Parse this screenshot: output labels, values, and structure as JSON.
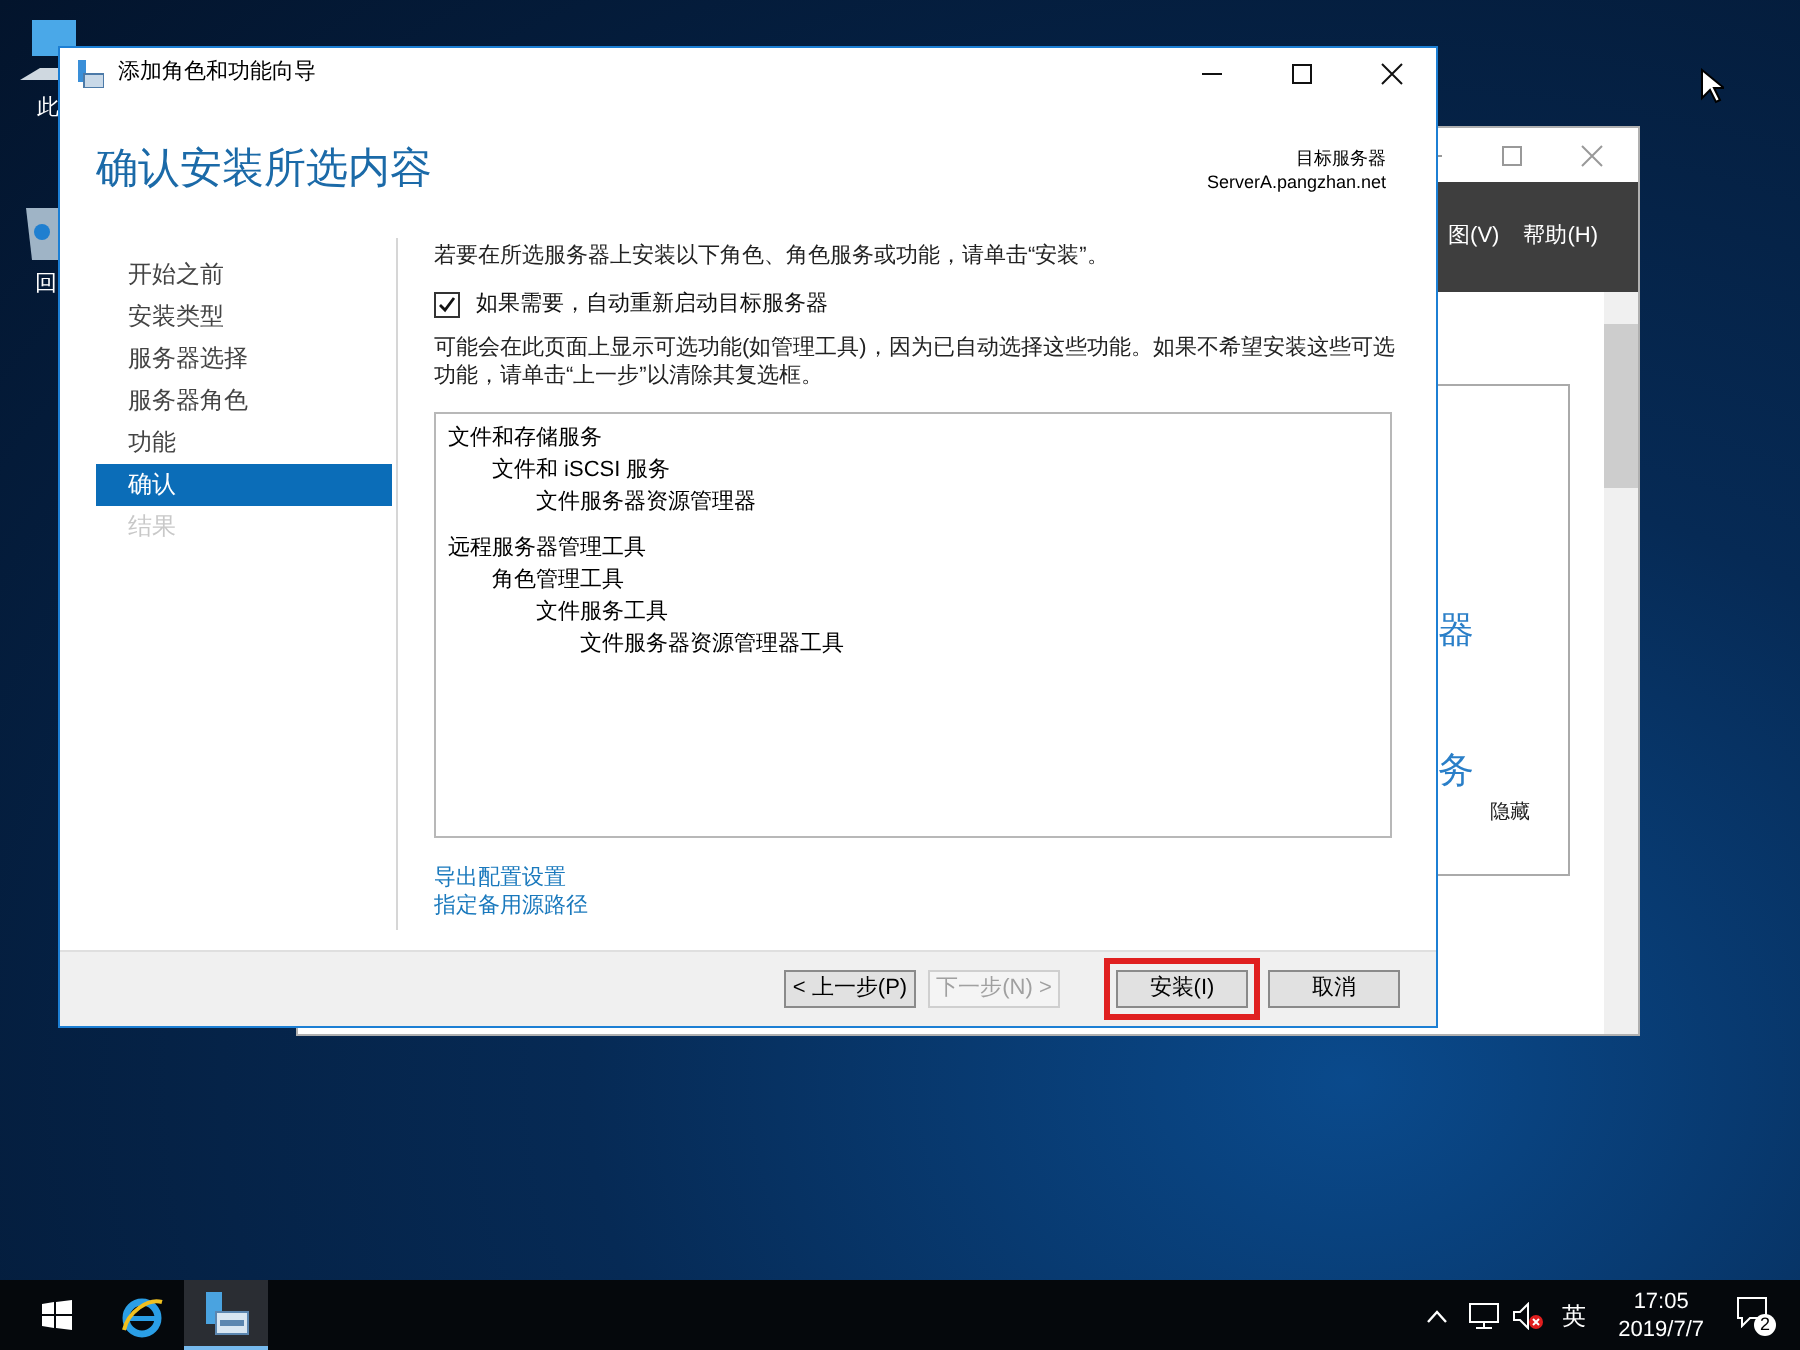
{
  "desktop_icons": [
    {
      "label": "此"
    },
    {
      "label": "回"
    }
  ],
  "background_window": {
    "menu": [
      "图(V)",
      "帮助(H)"
    ],
    "content_texts": [
      "器",
      "务"
    ],
    "hide_label": "隐藏"
  },
  "dialog": {
    "title": "添加角色和功能向导",
    "heading": "确认安装所选内容",
    "target_label": "目标服务器",
    "target_server": "ServerA.pangzhan.net",
    "steps": [
      {
        "label": "开始之前",
        "selected": false,
        "disabled": false
      },
      {
        "label": "安装类型",
        "selected": false,
        "disabled": false
      },
      {
        "label": "服务器选择",
        "selected": false,
        "disabled": false
      },
      {
        "label": "服务器角色",
        "selected": false,
        "disabled": false
      },
      {
        "label": "功能",
        "selected": false,
        "disabled": false
      },
      {
        "label": "确认",
        "selected": true,
        "disabled": false
      },
      {
        "label": "结果",
        "selected": false,
        "disabled": true
      }
    ],
    "intro": "若要在所选服务器上安装以下角色、角色服务或功能，请单击“安装”。",
    "restart_checkbox": {
      "label": "如果需要，自动重新启动目标服务器",
      "checked": true
    },
    "note": "可能会在此页面上显示可选功能(如管理工具)，因为已自动选择这些功能。如果不希望安装这些可选功能，请单击“上一步”以清除其复选框。",
    "tree": [
      {
        "label": "文件和存储服务",
        "children": [
          {
            "label": "文件和 iSCSI 服务",
            "children": [
              {
                "label": "文件服务器资源管理器"
              }
            ]
          }
        ]
      },
      {
        "label": "远程服务器管理工具",
        "children": [
          {
            "label": "角色管理工具",
            "children": [
              {
                "label": "文件服务工具",
                "children": [
                  {
                    "label": "文件服务器资源管理器工具"
                  }
                ]
              }
            ]
          }
        ]
      }
    ],
    "links": [
      "导出配置设置",
      "指定备用源路径"
    ],
    "buttons": [
      {
        "label": "< 上一步(P)",
        "disabled": false,
        "highlighted": false
      },
      {
        "label": "下一步(N) >",
        "disabled": true,
        "highlighted": false
      },
      {
        "label": "安装(I)",
        "disabled": false,
        "highlighted": true
      },
      {
        "label": "取消",
        "disabled": false,
        "highlighted": false
      }
    ]
  },
  "taskbar": {
    "apps": [
      {
        "kind": "ie",
        "active": false
      },
      {
        "kind": "server",
        "active": true
      }
    ],
    "ime": "英",
    "time": "17:05",
    "date": "2019/7/7",
    "notification_count": "2"
  }
}
